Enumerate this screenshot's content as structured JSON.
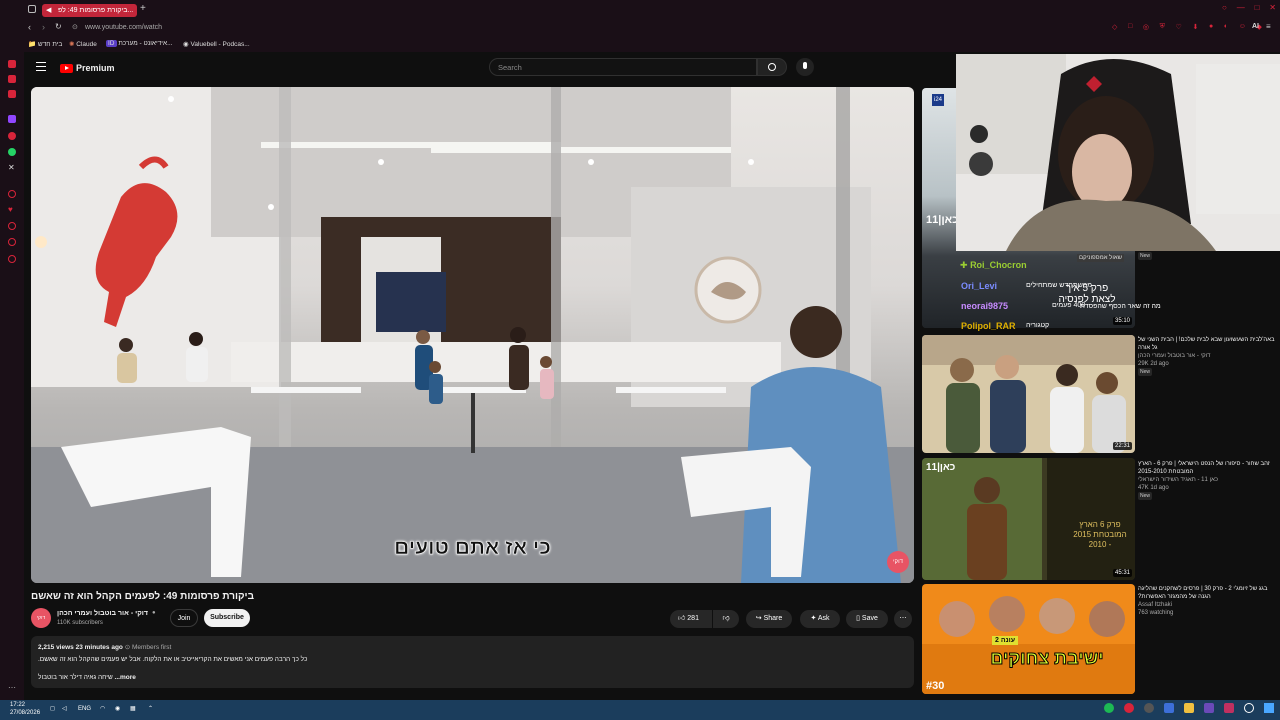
{
  "browser": {
    "tab_title": "ביקורת פרסומות 49: לפ...",
    "url": "www.youtube.com/watch",
    "bookmarks": [
      "בית חדש",
      "Claude",
      "אידיאונט - מערכת...",
      "Valuebell - Podcas..."
    ],
    "ai_label": "AI"
  },
  "header": {
    "logo": "Premium",
    "search_placeholder": "Search"
  },
  "video": {
    "caption": "כי אז אתם טועים",
    "badge": "דוקי"
  },
  "info": {
    "title": "ביקורת פרסומות 49: לפעמים הקהל הוא זה שאשם",
    "channel": "דוקי - אור בוטבול ועמרי הכהן",
    "subscribers": "110K subscribers",
    "join": "Join",
    "subscribe": "Subscribe",
    "likes": "281",
    "share": "Share",
    "ask": "Ask",
    "save": "Save"
  },
  "description": {
    "stats": "2,215 views  23 minutes ago",
    "members": "Members first",
    "line1": "כל כך הרבה פעמים אני מאשים את הקריאייטיב או את הלקוח. אבל יש פעמים שהקהל הוא זה שאשם.",
    "line2": "...more",
    "line2_prefix": "שיחה גאיה דילר אור בוטבול"
  },
  "overlay_chat": [
    {
      "user": "Roi_Chocron",
      "color": "#9acd32"
    },
    {
      "user": "Ori_Levi",
      "color": "#7b8cff"
    },
    {
      "user": "neorai9875",
      "color": "#c78bff"
    },
    {
      "user": "Polipol_RAR",
      "color": "#e0b000"
    }
  ],
  "sidebar": [
    {
      "title": "",
      "channel": "",
      "stats": "",
      "duration": "35:10",
      "badge": "New",
      "thumb_text": "פרק 5 איך לצאת לפנסיה",
      "bg": "#2a2a2a"
    },
    {
      "title": "באה'לבית השעשועון שבא לבית שלכם! | הבית השני של גל אורה",
      "channel": "דוקי - אור בוטבול ועמרי הכהן",
      "stats": "29K  2d ago",
      "duration": "22:31",
      "badge": "New",
      "bg": "#d9c7a4"
    },
    {
      "title": "זהב שחור - סיפורו של הנפט הישראלי | פרק 6 - הארץ המובטחת 2015-2010",
      "channel": "כאן 11 - תאגיד השידור הישראלי",
      "stats": "47K  1d ago",
      "duration": "45:31",
      "badge": "New",
      "thumb_text": "פרק 6 הארץ המובטחת 2015 - 2010",
      "bg": "#2b2a1d"
    },
    {
      "title": "בגג של זיומג'י 2 - פרק 30 | פרסים לשחקנים שהליגה הגנה של מהמגזר האפשרות?",
      "channel": "Assaf Itzhaki",
      "stats": "763 watching",
      "duration": "",
      "badge": "",
      "thumb_text": "ישיבת צחוקים",
      "bg": "#1f3a55"
    }
  ],
  "misc_labels": {
    "members_first_prefix": "Members first",
    "channel_logo": "כאן|11",
    "i24": "i24",
    "overlay_text_1": "מה זה שאר הכסף שהפסדת",
    "overlay_text_2": "מהשתחדש שמתחילים",
    "overlay_text_3": "400 פעמים",
    "overlay_text_4": "קטגוריה",
    "overlay_tag": "שאול אמספוניקם",
    "season_label": "עונה 2",
    "episode_label": "#30"
  },
  "taskbar": {
    "time": "17:22",
    "date": "27/08/2026",
    "lang": "ENG"
  }
}
